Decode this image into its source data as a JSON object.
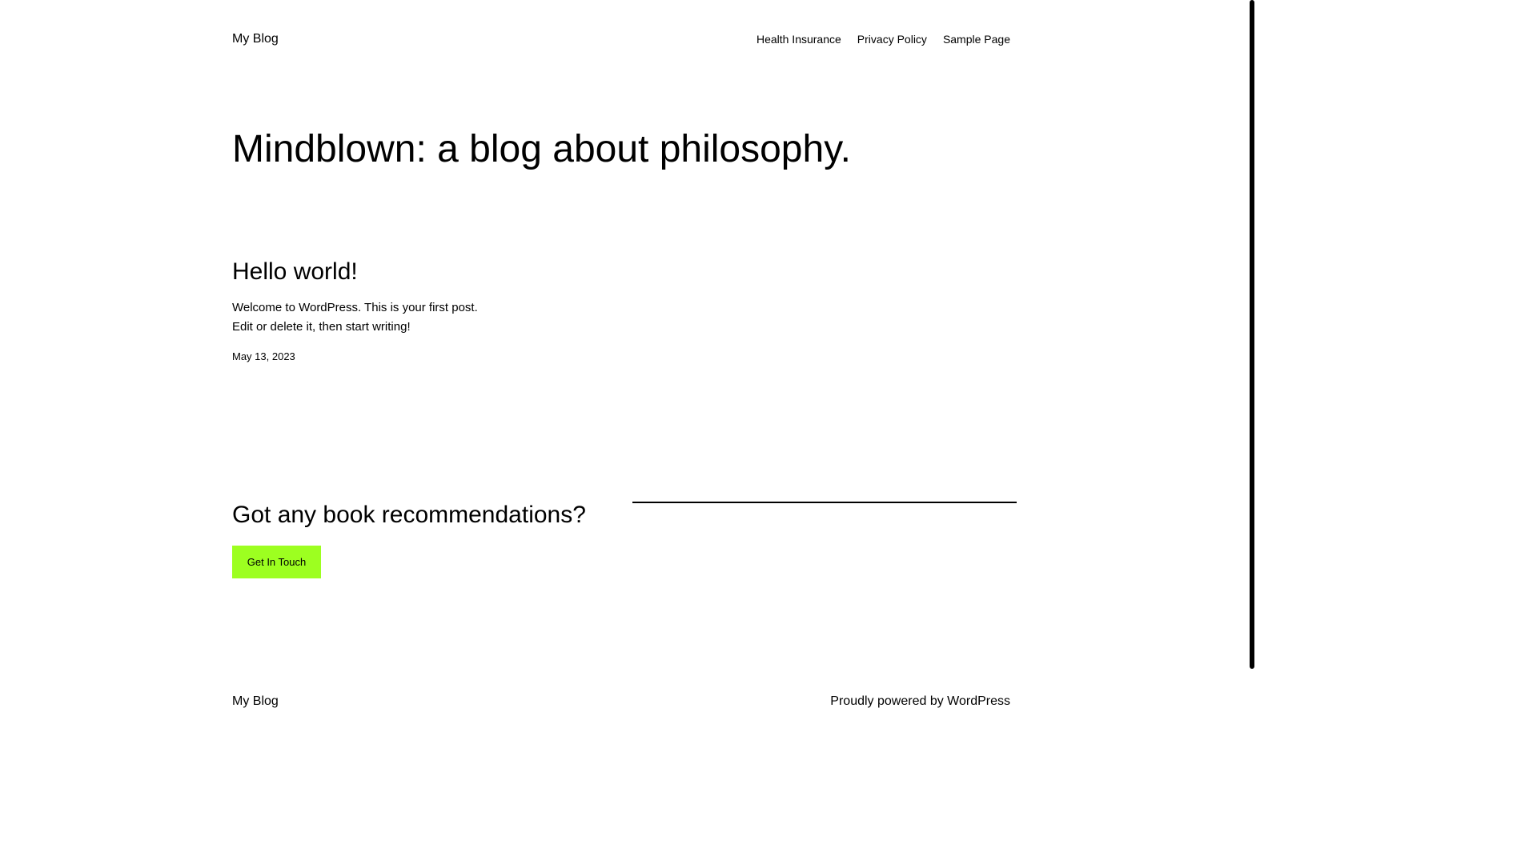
{
  "header": {
    "site_title": "My Blog",
    "nav": [
      {
        "label": "Health Insurance"
      },
      {
        "label": "Privacy Policy"
      },
      {
        "label": "Sample Page"
      }
    ]
  },
  "hero": {
    "tagline": "Mindblown: a blog about philosophy."
  },
  "post": {
    "title": "Hello world!",
    "excerpt_line1": "Welcome to WordPress. This is your first post.",
    "excerpt_line2": "Edit or delete it, then start writing!",
    "date": "May 13, 2023"
  },
  "cta": {
    "heading": "Got any book recommendations?",
    "button_label": "Get In Touch",
    "button_color": "#9dff20"
  },
  "footer": {
    "site_title": "My Blog",
    "credit_prefix": "Proudly powered by ",
    "credit_link": "WordPress"
  }
}
